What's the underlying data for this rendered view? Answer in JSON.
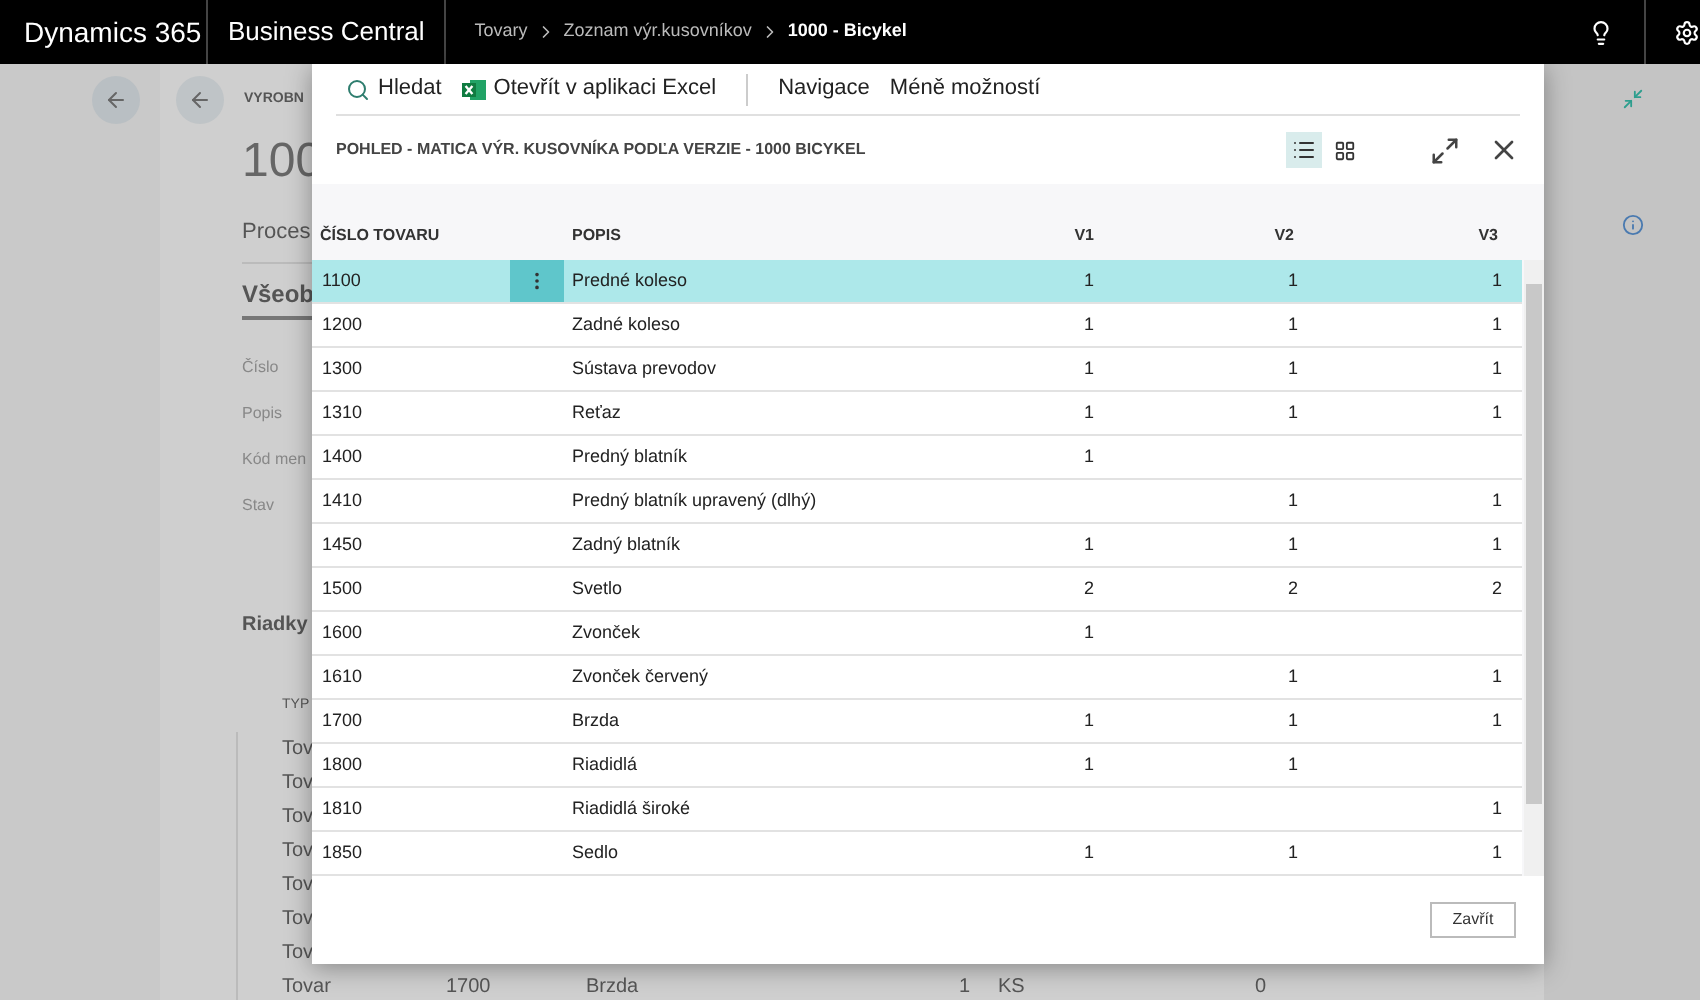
{
  "top_bar": {
    "product": "Dynamics 365",
    "app": "Business Central",
    "breadcrumb": [
      {
        "label": "Tovary",
        "current": false
      },
      {
        "label": "Zoznam výr.kusovníkov",
        "current": false
      },
      {
        "label": "1000 - Bicykel",
        "current": true
      }
    ]
  },
  "background_page": {
    "caption": "VYROBN",
    "title": "100",
    "tab": "Proces",
    "section": "Všeob",
    "fields": [
      "Číslo",
      "Popis",
      "Kód men",
      "Stav"
    ],
    "lines_heading": "Riadky",
    "lines_column": "TYP",
    "line_types": [
      "Tov",
      "Tov",
      "Tov",
      "Tov",
      "Tov",
      "Tov",
      "Tov"
    ],
    "last_line": {
      "type": "Tovar",
      "number": "1700",
      "description": "Brzda",
      "quantity": "1",
      "unit": "KS",
      "column_6": "0"
    }
  },
  "dialog": {
    "actions": [
      {
        "label": "Hledat",
        "kind": "search"
      },
      {
        "label": "Otevřít v aplikaci Excel",
        "kind": "excel"
      },
      {
        "label": "Navigace",
        "kind": "text"
      },
      {
        "label": "Méně možností",
        "kind": "text"
      }
    ],
    "title": "POHLED - MATICA VÝR. KUSOVNÍKA PODĽA VERZIE - 1000 BICYKEL",
    "views": [
      {
        "kind": "list",
        "selected": true
      },
      {
        "kind": "tiles",
        "selected": false
      }
    ],
    "columns": [
      "ČÍSLO TOVARU",
      "POPIS",
      "V1",
      "V2",
      "V3"
    ],
    "rows": [
      {
        "number": "1100",
        "description": "Predné koleso",
        "v1": "1",
        "v2": "1",
        "v3": "1",
        "selected": true
      },
      {
        "number": "1200",
        "description": "Zadné koleso",
        "v1": "1",
        "v2": "1",
        "v3": "1",
        "selected": false
      },
      {
        "number": "1300",
        "description": "Sústava prevodov",
        "v1": "1",
        "v2": "1",
        "v3": "1",
        "selected": false
      },
      {
        "number": "1310",
        "description": "Reťaz",
        "v1": "1",
        "v2": "1",
        "v3": "1",
        "selected": false
      },
      {
        "number": "1400",
        "description": "Predný blatník",
        "v1": "1",
        "selected": false
      },
      {
        "number": "1410",
        "description": "Predný blatník upravený (dlhý)",
        "v2": "1",
        "v3": "1",
        "selected": false
      },
      {
        "number": "1450",
        "description": "Zadný blatník",
        "v1": "1",
        "v2": "1",
        "v3": "1",
        "selected": false
      },
      {
        "number": "1500",
        "description": "Svetlo",
        "v1": "2",
        "v2": "2",
        "v3": "2",
        "selected": false
      },
      {
        "number": "1600",
        "description": "Zvonček",
        "v1": "1",
        "selected": false
      },
      {
        "number": "1610",
        "description": "Zvonček červený",
        "v2": "1",
        "v3": "1",
        "selected": false
      },
      {
        "number": "1700",
        "description": "Brzda",
        "v1": "1",
        "v2": "1",
        "v3": "1",
        "selected": false
      },
      {
        "number": "1800",
        "description": "Riadidlá",
        "v1": "1",
        "v2": "1",
        "selected": false
      },
      {
        "number": "1810",
        "description": "Riadidlá široké",
        "v3": "1",
        "selected": false
      },
      {
        "number": "1850",
        "description": "Sedlo",
        "v1": "1",
        "v2": "1",
        "v3": "1",
        "selected": false
      }
    ],
    "close_button": "Zavřít"
  }
}
